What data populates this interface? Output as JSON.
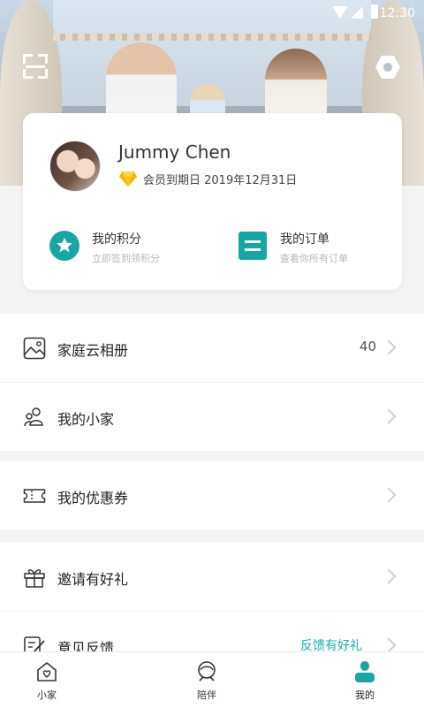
{
  "status_bar": {
    "time": "12:30"
  },
  "profile": {
    "name": "Jummy Chen",
    "membership": "会员到期日 2019年12月31日"
  },
  "stats": {
    "points": {
      "title": "我的积分",
      "subtitle": "立即签到领积分"
    },
    "orders": {
      "title": "我的订单",
      "subtitle": "查看你所有订单"
    }
  },
  "menu": {
    "album": {
      "label": "家庭云相册",
      "value": "40"
    },
    "home": {
      "label": "我的小家"
    },
    "coupons": {
      "label": "我的优惠券"
    },
    "invite": {
      "label": "邀请有好礼"
    },
    "feedback": {
      "label": "意见反馈",
      "tag": "反馈有好礼"
    }
  },
  "tabs": [
    {
      "label": "小家",
      "icon": "home-heart-icon",
      "active": false
    },
    {
      "label": "陪伴",
      "icon": "companion-icon",
      "active": false
    },
    {
      "label": "我的",
      "icon": "profile-icon",
      "active": true
    }
  ],
  "colors": {
    "accent": "#1aa5a5",
    "accent_light": "#1bb0b0",
    "vip_gold": "#f5b700"
  }
}
